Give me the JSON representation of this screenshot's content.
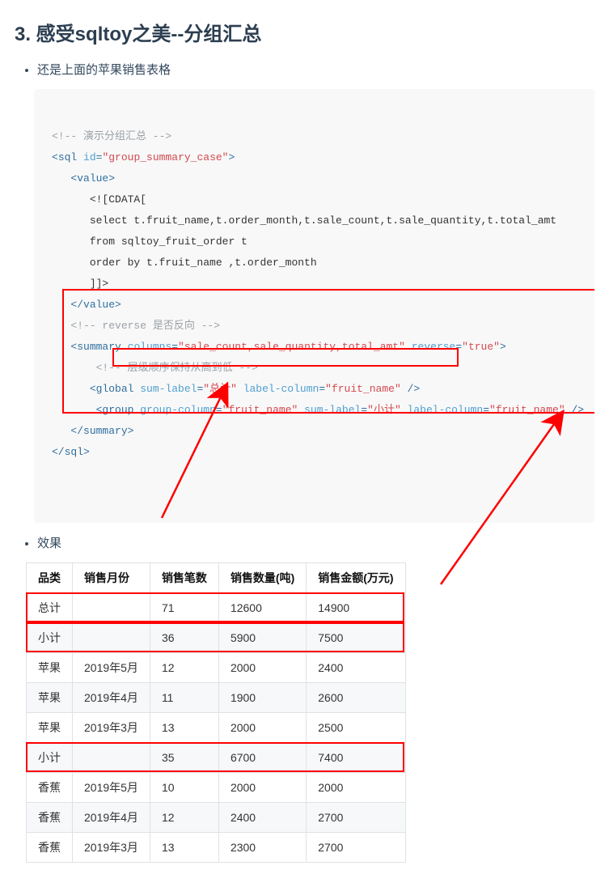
{
  "heading": "3. 感受sqltoy之美--分组汇总",
  "bullet1": "还是上面的苹果销售表格",
  "bullet2": "效果",
  "code": {
    "c1": "<!-- 演示分组汇总 -->",
    "sql_open_a": "sql",
    "sql_id_attr": "id",
    "sql_id_val": "\"group_summary_case\"",
    "value_tag": "value",
    "cdata_open": "<![CDATA[",
    "line_select": "select t.fruit_name,t.order_month,t.sale_count,t.sale_quantity,t.total_amt",
    "line_from": "from sqltoy_fruit_order t",
    "line_order": "order by t.fruit_name ,t.order_month",
    "cdata_close": "]]>",
    "c2": "<!-- reverse 是否反向 -->",
    "summary_tag": "summary",
    "summary_cols_attr": "columns",
    "summary_cols_val": "\"sale_count,sale_quantity,total_amt\"",
    "summary_rev_attr": "reverse",
    "summary_rev_val": "\"true\"",
    "c3": "<!-- 层级顺序保持从高到低 -->",
    "global_tag": "global",
    "global_sl_attr": "sum-label",
    "global_sl_val": "\"总计\"",
    "global_lc_attr": "label-column",
    "global_lc_val": "\"fruit_name\"",
    "group_tag": "group",
    "group_gc_attr": "group-column",
    "group_gc_val": "\"fruit_name\"",
    "group_sl_attr": "sum-label",
    "group_sl_val": "\"小计\"",
    "group_lc_attr": "label-column",
    "group_lc_val": "\"fruit_name\""
  },
  "table": {
    "headers": [
      "品类",
      "销售月份",
      "销售笔数",
      "销售数量(吨)",
      "销售金额(万元)"
    ],
    "rows": [
      {
        "cells": [
          "总计",
          "",
          "71",
          "12600",
          "14900"
        ],
        "hl": true
      },
      {
        "cells": [
          "小计",
          "",
          "36",
          "5900",
          "7500"
        ],
        "hl": true
      },
      {
        "cells": [
          "苹果",
          "2019年5月",
          "12",
          "2000",
          "2400"
        ],
        "hl": false
      },
      {
        "cells": [
          "苹果",
          "2019年4月",
          "11",
          "1900",
          "2600"
        ],
        "hl": false
      },
      {
        "cells": [
          "苹果",
          "2019年3月",
          "13",
          "2000",
          "2500"
        ],
        "hl": false
      },
      {
        "cells": [
          "小计",
          "",
          "35",
          "6700",
          "7400"
        ],
        "hl": true
      },
      {
        "cells": [
          "香蕉",
          "2019年5月",
          "10",
          "2000",
          "2000"
        ],
        "hl": false
      },
      {
        "cells": [
          "香蕉",
          "2019年4月",
          "12",
          "2400",
          "2700"
        ],
        "hl": false
      },
      {
        "cells": [
          "香蕉",
          "2019年3月",
          "13",
          "2300",
          "2700"
        ],
        "hl": false
      }
    ]
  },
  "chart_data": {
    "type": "table",
    "headers": [
      "品类",
      "销售月份",
      "销售笔数",
      "销售数量(吨)",
      "销售金额(万元)"
    ],
    "rows": [
      [
        "总计",
        "",
        71,
        12600,
        14900
      ],
      [
        "小计",
        "",
        36,
        5900,
        7500
      ],
      [
        "苹果",
        "2019年5月",
        12,
        2000,
        2400
      ],
      [
        "苹果",
        "2019年4月",
        11,
        1900,
        2600
      ],
      [
        "苹果",
        "2019年3月",
        13,
        2000,
        2500
      ],
      [
        "小计",
        "",
        35,
        6700,
        7400
      ],
      [
        "香蕉",
        "2019年5月",
        10,
        2000,
        2000
      ],
      [
        "香蕉",
        "2019年4月",
        12,
        2400,
        2700
      ],
      [
        "香蕉",
        "2019年3月",
        13,
        2300,
        2700
      ]
    ]
  }
}
